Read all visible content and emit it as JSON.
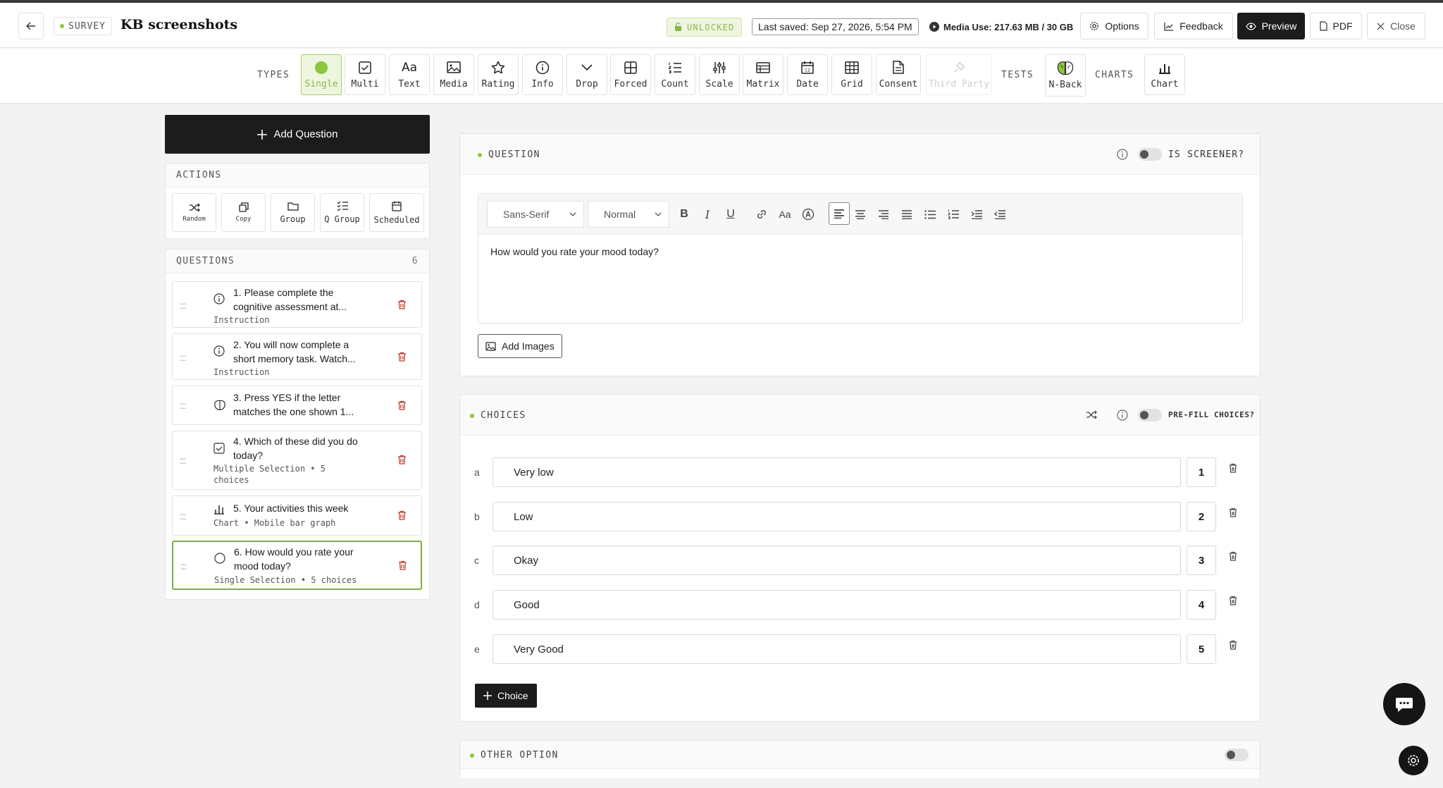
{
  "header": {
    "back_icon": "arrow-left-icon",
    "survey_tag": "SURVEY",
    "title": "KB screenshots",
    "unlocked_label": "UNLOCKED",
    "last_saved": "Last saved: Sep 27, 2026, 5:54 PM",
    "media_use": "Media Use: 217.63 MB / 30 GB",
    "buttons": {
      "options": "Options",
      "feedback": "Feedback",
      "preview": "Preview",
      "pdf": "PDF",
      "close": "Close"
    }
  },
  "toolbar": {
    "types_label": "TYPES",
    "tests_label": "TESTS",
    "charts_label": "CHARTS",
    "types": [
      {
        "label": "Single",
        "icon": "radio-dot-icon"
      },
      {
        "label": "Multi",
        "icon": "checkbox-icon"
      },
      {
        "label": "Text",
        "icon": "text-aa-icon"
      },
      {
        "label": "Media",
        "icon": "image-icon"
      },
      {
        "label": "Rating",
        "icon": "star-icon"
      },
      {
        "label": "Info",
        "icon": "info-icon"
      },
      {
        "label": "Drop",
        "icon": "chevron-down-icon"
      },
      {
        "label": "Forced",
        "icon": "grid-icon"
      },
      {
        "label": "Count",
        "icon": "numbered-list-icon"
      },
      {
        "label": "Scale",
        "icon": "sliders-icon"
      },
      {
        "label": "Matrix",
        "icon": "matrix-icon"
      },
      {
        "label": "Date",
        "icon": "calendar-icon"
      },
      {
        "label": "Grid",
        "icon": "table-icon"
      },
      {
        "label": "Consent",
        "icon": "document-icon"
      },
      {
        "label": "Third Party",
        "icon": "plug-icon"
      }
    ],
    "tests": [
      {
        "label": "N-Back",
        "icon": "brain-icon"
      }
    ],
    "charts": [
      {
        "label": "Chart",
        "icon": "bar-chart-icon"
      }
    ]
  },
  "sidebar": {
    "add_question": "Add Question",
    "actions_label": "ACTIONS",
    "actions": [
      {
        "label": "Random",
        "icon": "shuffle-icon"
      },
      {
        "label": "Copy",
        "icon": "copy-icon"
      },
      {
        "label": "Group",
        "icon": "folder-icon"
      },
      {
        "label": "Q Group",
        "icon": "list-check-icon"
      },
      {
        "label": "Scheduled",
        "icon": "calendar-icon"
      }
    ],
    "questions_label": "QUESTIONS",
    "questions_count": "6",
    "questions": [
      {
        "title": "1. Please complete the cognitive assessment at...",
        "subtitle": "Instruction",
        "icon": "info-icon"
      },
      {
        "title": "2. You will now complete a short memory task. Watch...",
        "subtitle": "Instruction",
        "icon": "info-icon"
      },
      {
        "title": "3. Press YES if the letter matches the one shown 1...",
        "subtitle": "",
        "icon": "brain-icon"
      },
      {
        "title": "4. Which of these did you do today?",
        "subtitle": "Multiple Selection • 5 choices",
        "icon": "checkbox-icon"
      },
      {
        "title": "5. Your activities this week",
        "subtitle": "Chart • Mobile bar graph",
        "icon": "bar-chart-icon"
      },
      {
        "title": "6. How would you rate your mood today?",
        "subtitle": "Single Selection • 5 choices",
        "icon": "radio-icon"
      }
    ]
  },
  "question_panel": {
    "label": "QUESTION",
    "screener_label": "IS SCREENER?",
    "font_select": "Sans-Serif",
    "size_select": "Normal",
    "text": "How would you rate your mood today?",
    "add_images": "Add Images"
  },
  "choices_panel": {
    "label": "CHOICES",
    "prefill_label": "PRE-FILL CHOICES?",
    "choices": [
      {
        "letter": "a",
        "text": "Very low",
        "value": "1"
      },
      {
        "letter": "b",
        "text": "Low",
        "value": "2"
      },
      {
        "letter": "c",
        "text": "Okay",
        "value": "3"
      },
      {
        "letter": "d",
        "text": "Good",
        "value": "4"
      },
      {
        "letter": "e",
        "text": "Very Good",
        "value": "5"
      }
    ],
    "add_choice": "Choice"
  },
  "other_panel": {
    "label": "OTHER OPTION"
  },
  "colors": {
    "accent_green": "#8dc63f",
    "dark": "#1c1c1c",
    "trash_red": "#c0392b"
  }
}
